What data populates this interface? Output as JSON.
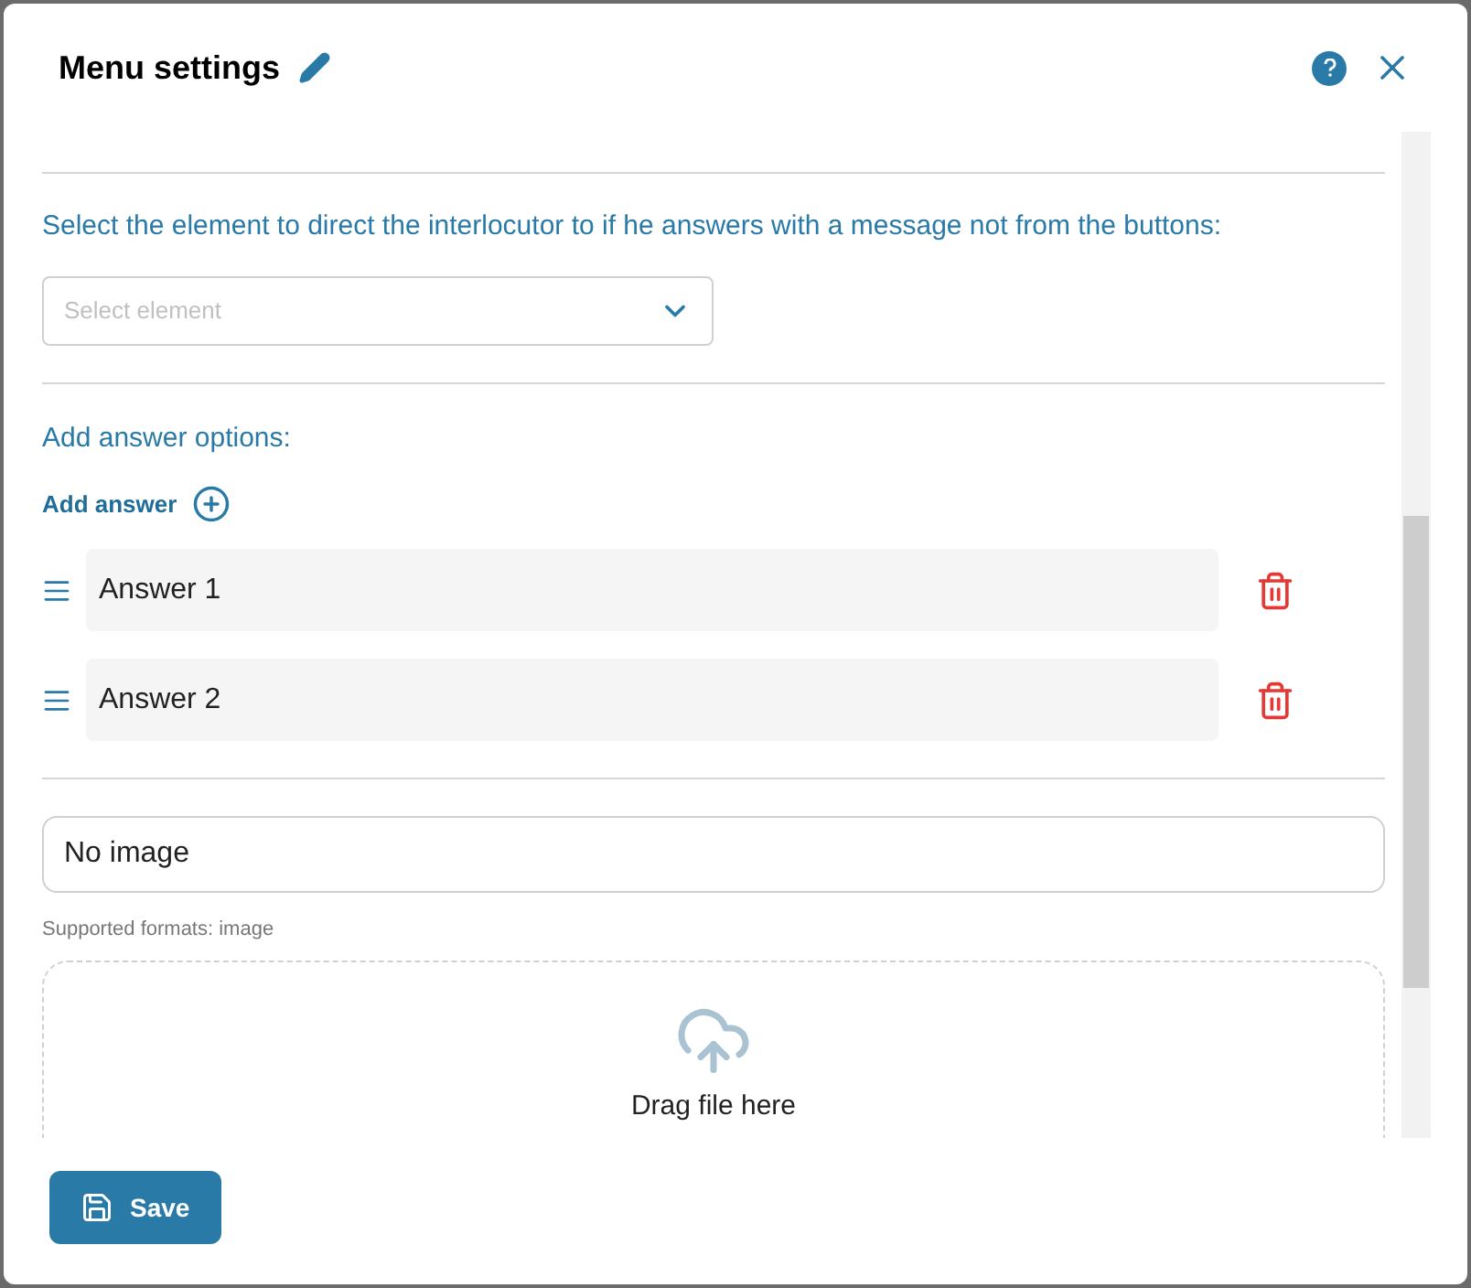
{
  "dialog": {
    "title": "Menu settings"
  },
  "redirect": {
    "label": "Select the element to direct the interlocutor to if he answers with a message not from the buttons:",
    "placeholder": "Select element"
  },
  "answers_section": {
    "label": "Add answer options:",
    "add_button": "Add answer"
  },
  "answers": [
    {
      "value": "Answer 1"
    },
    {
      "value": "Answer 2"
    }
  ],
  "image": {
    "value": "No image",
    "hint": "Supported formats: image",
    "drop_text": "Drag file here"
  },
  "footer": {
    "save_button": "Save"
  }
}
